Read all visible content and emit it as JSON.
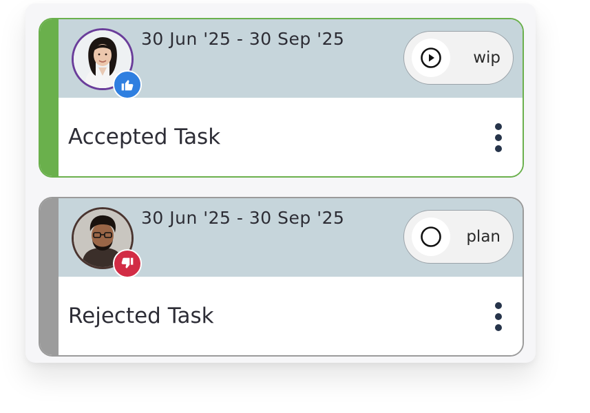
{
  "tasks": [
    {
      "date_range": "30 Jun '25 - 30 Sep '25",
      "status_label": "wip",
      "status_icon": "play-circle-icon",
      "vote_icon": "thumbs-up-icon",
      "title": "Accepted Task",
      "accent_color": "#6ab04c",
      "vote_color": "#2f7fe0"
    },
    {
      "date_range": "30 Jun '25 - 30 Sep '25",
      "status_label": "plan",
      "status_icon": "empty-circle-icon",
      "vote_icon": "thumbs-down-icon",
      "title": "Rejected Task",
      "accent_color": "#9c9c9c",
      "vote_color": "#d22c45"
    }
  ]
}
